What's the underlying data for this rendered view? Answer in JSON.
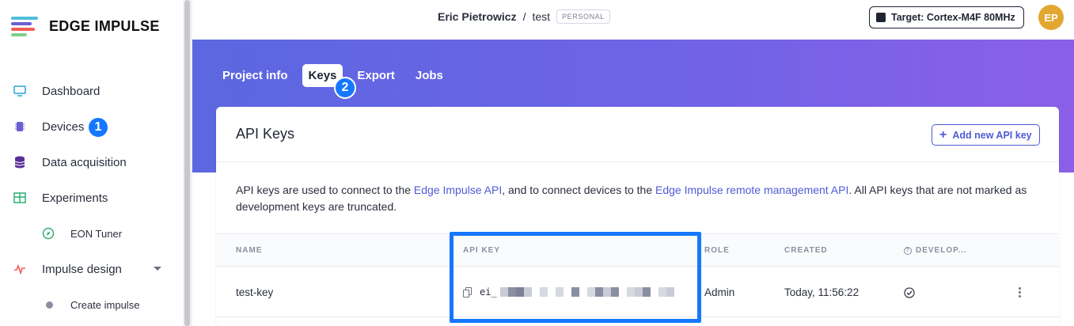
{
  "brand": {
    "name": "EDGE IMPULSE",
    "logo_colors": [
      "#4fbfd9",
      "#f25c54",
      "#6b5fd3",
      "#7fd08c"
    ]
  },
  "sidebar": {
    "items": [
      {
        "label": "Dashboard",
        "icon": "monitor-icon",
        "color": "#23a6d5"
      },
      {
        "label": "Devices",
        "icon": "chip-icon",
        "color": "#6b5fd3"
      },
      {
        "label": "Data acquisition",
        "icon": "database-icon",
        "color": "#5a2e99"
      },
      {
        "label": "Experiments",
        "icon": "grid-icon",
        "color": "#2fae73"
      },
      {
        "label": "EON Tuner",
        "icon": "compass-icon",
        "color": "#2fae73"
      },
      {
        "label": "Impulse design",
        "icon": "pulse-icon",
        "color": "#f25c54"
      },
      {
        "label": "Create impulse",
        "icon": "dot-icon",
        "color": "#8a8fa0"
      }
    ],
    "step_badges": [
      "1",
      "2"
    ]
  },
  "topbar": {
    "user": "Eric Pietrowicz",
    "separator": "/",
    "project": "test",
    "project_tag": "PERSONAL",
    "target_label": "Target: Cortex-M4F 80MHz",
    "avatar_initials": "EP"
  },
  "tabs": [
    {
      "label": "Project info",
      "active": false
    },
    {
      "label": "Keys",
      "active": true
    },
    {
      "label": "Export",
      "active": false
    },
    {
      "label": "Jobs",
      "active": false
    }
  ],
  "card": {
    "title": "API Keys",
    "add_button": "Add new API key",
    "desc_1": "API keys are used to connect to the ",
    "link_1": "Edge Impulse API",
    "desc_2": ", and to connect devices to the ",
    "link_2": "Edge Impulse remote management API",
    "desc_3": ". All API keys that are not marked as development keys are truncated."
  },
  "table": {
    "headers": [
      "NAME",
      "API KEY",
      "ROLE",
      "CREATED",
      "DEVELOP..."
    ],
    "rows": [
      {
        "name": "test-key",
        "key_prefix": "ei_",
        "role": "Admin",
        "created": "Today, 11:56:22"
      }
    ]
  },
  "colors": {
    "accent": "#4f5bd5",
    "highlight": "#1677ff",
    "avatar": "#e3a72f"
  }
}
